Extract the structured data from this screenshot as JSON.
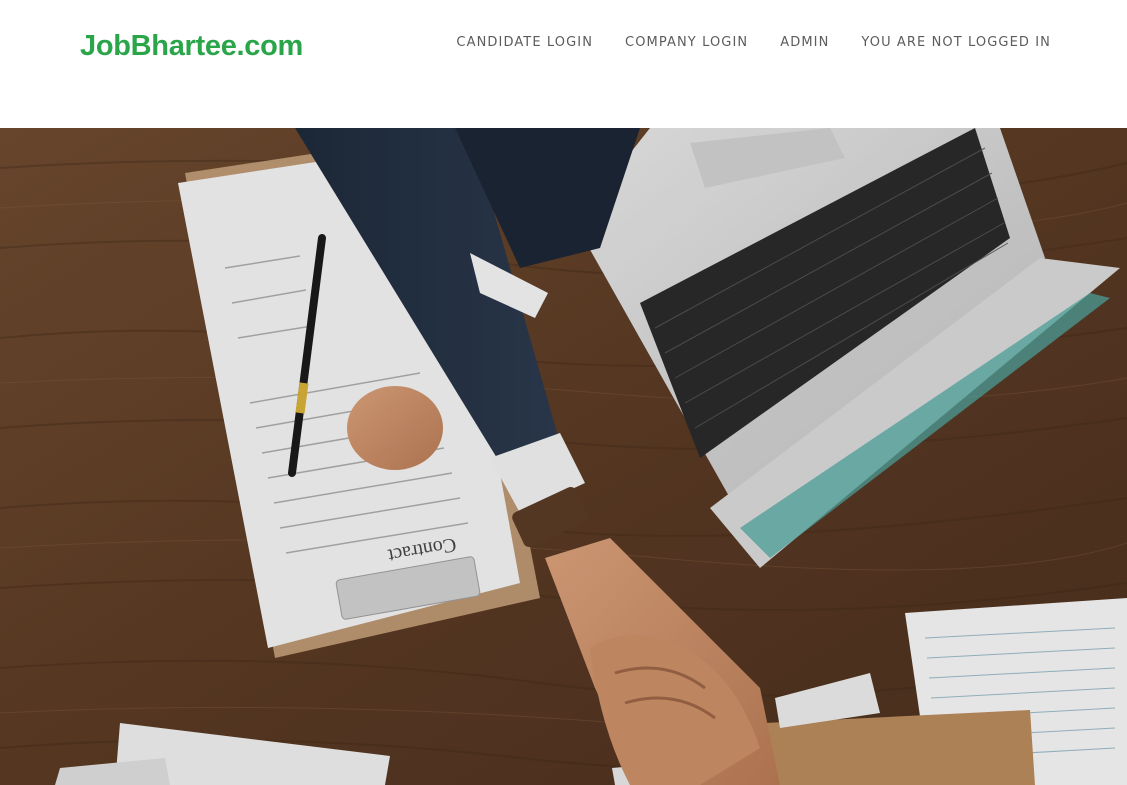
{
  "brand": {
    "name": "JobBhartee.com",
    "color": "#2aa54a"
  },
  "nav": {
    "items": [
      {
        "label": "CANDIDATE LOGIN"
      },
      {
        "label": "COMPANY LOGIN"
      },
      {
        "label": "ADMIN"
      },
      {
        "label": "YOU ARE NOT LOGGED IN"
      }
    ]
  },
  "hero": {
    "image": "handshake-over-desk-with-contract-and-laptop",
    "document_heading": "Contract"
  }
}
